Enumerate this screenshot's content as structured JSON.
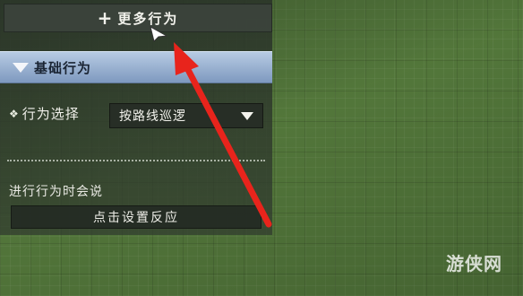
{
  "panel": {
    "more_behaviors_label": "更多行为",
    "section_title": "基础行为",
    "behavior_select_label": "行为选择",
    "behavior_select_value": "按路线巡逻",
    "say_label": "进行行为时会说",
    "reaction_button_label": "点击设置反应"
  },
  "watermark": "游侠网",
  "colors": {
    "arrow": "#e8241c",
    "header_blue": "#8fa8c8",
    "ground_green": "#557a3c"
  },
  "icons": [
    "plus-icon",
    "collapse-triangle-icon",
    "diamond-bullet-icon",
    "dropdown-caret-icon",
    "mouse-cursor-icon",
    "annotation-arrow"
  ]
}
